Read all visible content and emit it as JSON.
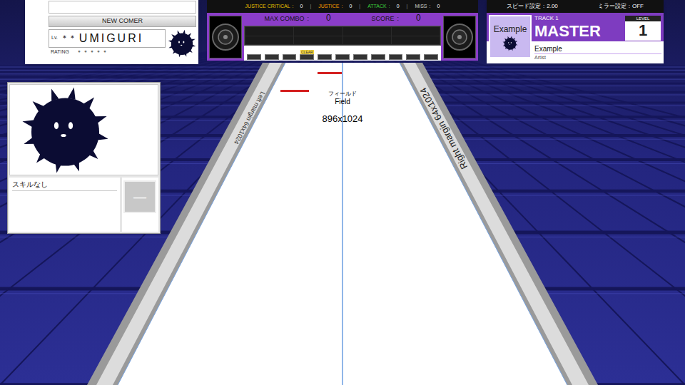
{
  "player": {
    "name_field": "",
    "title": "NEW COMER",
    "level_label": "Lv.",
    "level": "＊＊",
    "name": "UMIGURI",
    "rating_label": "RATING",
    "rating": "＊＊＊＊＊"
  },
  "judgements": [
    {
      "label": "JUSTICE CRITICAL",
      "value": "0",
      "color": "#e8c200"
    },
    {
      "label": "JUSTICE",
      "value": "0",
      "color": "#ff9a00"
    },
    {
      "label": "ATTACK",
      "value": "0",
      "color": "#3ccf3c"
    },
    {
      "label": "MISS",
      "value": "0",
      "color": "#cccccc"
    }
  ],
  "separator": "|",
  "colon": ":",
  "max_combo": {
    "label": "MAX COMBO",
    "value": "0"
  },
  "score": {
    "label": "SCORE",
    "value": "0"
  },
  "gauge": {
    "clear_label": "CLEAR",
    "cells": [
      {
        "filled": false,
        "clear": false
      },
      {
        "filled": false,
        "clear": false
      },
      {
        "filled": false,
        "clear": false
      },
      {
        "filled": false,
        "clear": true
      },
      {
        "filled": false,
        "clear": false
      },
      {
        "filled": false,
        "clear": false
      },
      {
        "filled": false,
        "clear": false
      },
      {
        "filled": false,
        "clear": false
      },
      {
        "filled": false,
        "clear": false
      },
      {
        "filled": false,
        "clear": false
      },
      {
        "filled": false,
        "clear": false
      }
    ]
  },
  "settings": [
    {
      "label": "スピード設定",
      "value": "2.00"
    },
    {
      "label": "ミラー設定",
      "value": "OFF"
    }
  ],
  "track": {
    "number_label": "TRACK 1",
    "difficulty": "MASTER",
    "level_label": "LEVEL",
    "level": "1",
    "jacket": "Example",
    "title": "Example",
    "artist": "Artist"
  },
  "character": {
    "skill": "スキルなし",
    "skill_icon": "—"
  },
  "field": {
    "label_ja": "フィールド",
    "label_en": "Field",
    "size": "896x1024",
    "left_rail": "Left margin 64x1024",
    "right_rail": "Right margin 64x1024"
  }
}
